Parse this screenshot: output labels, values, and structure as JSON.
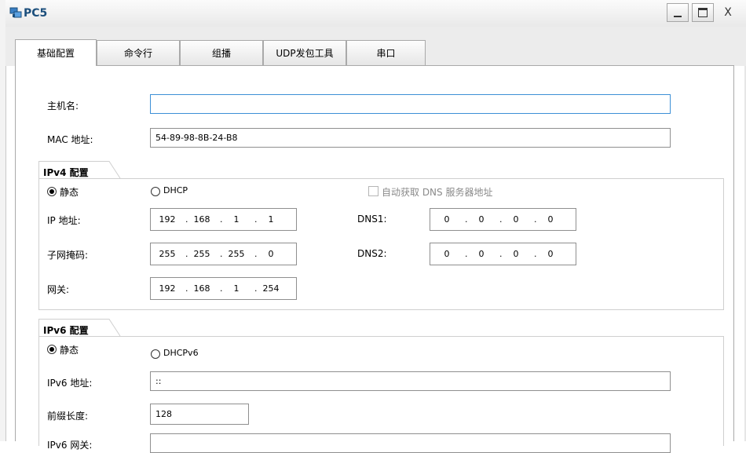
{
  "window": {
    "title": "PC5",
    "close_glyph": "X"
  },
  "tabs": [
    {
      "label": "基础配置",
      "active": true
    },
    {
      "label": "命令行"
    },
    {
      "label": "组播"
    },
    {
      "label": "UDP发包工具"
    },
    {
      "label": "串口"
    }
  ],
  "basic": {
    "hostname_label": "主机名:",
    "hostname_value": "",
    "mac_label": "MAC 地址:",
    "mac_value": "54-89-98-8B-24-B8"
  },
  "ipv4": {
    "group_title": "IPv4 配置",
    "static_label": "静态",
    "dhcp_label": "DHCP",
    "auto_dns_label": "自动获取 DNS 服务器地址",
    "ip_label": "IP 地址:",
    "ip": [
      "192",
      "168",
      "1",
      "1"
    ],
    "mask_label": "子网掩码:",
    "mask": [
      "255",
      "255",
      "255",
      "0"
    ],
    "gateway_label": "网关:",
    "gateway": [
      "192",
      "168",
      "1",
      "254"
    ],
    "dns1_label": "DNS1:",
    "dns1": [
      "0",
      "0",
      "0",
      "0"
    ],
    "dns2_label": "DNS2:",
    "dns2": [
      "0",
      "0",
      "0",
      "0"
    ]
  },
  "ipv6": {
    "group_title": "IPv6 配置",
    "static_label": "静态",
    "dhcp_label": "DHCPv6",
    "addr_label": "IPv6 地址:",
    "addr_value": "::",
    "prefix_label": "前缀长度:",
    "prefix_value": "128",
    "gateway_label": "IPv6 网关:",
    "gateway_value": ""
  },
  "colors": {
    "title_text": "#1c4f7c",
    "focus_border": "#3c8fd6",
    "tab_bg": "#ececec"
  }
}
